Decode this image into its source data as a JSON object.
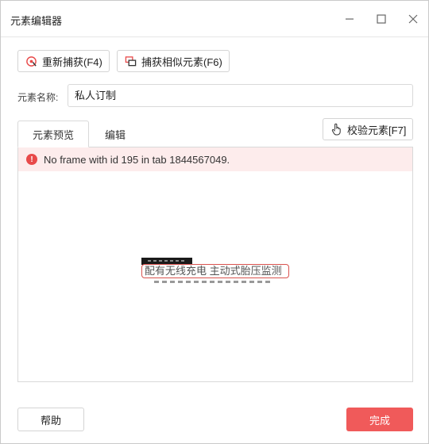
{
  "window": {
    "title": "元素编辑器"
  },
  "toolbar": {
    "recapture_label": "重新捕获(F4)",
    "capture_similar_label": "捕获相似元素(F6)"
  },
  "form": {
    "name_label": "元素名称:",
    "name_value": "私人订制"
  },
  "tabs": [
    {
      "label": "元素预览",
      "active": true
    },
    {
      "label": "编辑",
      "active": false
    }
  ],
  "validate": {
    "label": "校验元素[F7]"
  },
  "error": {
    "message": "No frame with id 195 in tab 1844567049."
  },
  "preview": {
    "selected_text": "配有无线充电 主动式胎压监测"
  },
  "footer": {
    "help_label": "帮助",
    "done_label": "完成"
  },
  "colors": {
    "accent": "#f05a5a",
    "error_bg": "#fdecec",
    "error_icon": "#e84a4a",
    "selection_border": "#d9534f"
  },
  "icons": {
    "recapture": "recapture-icon",
    "capture_similar": "capture-similar-icon",
    "validate": "hand-pointer-icon",
    "error": "error-icon"
  }
}
